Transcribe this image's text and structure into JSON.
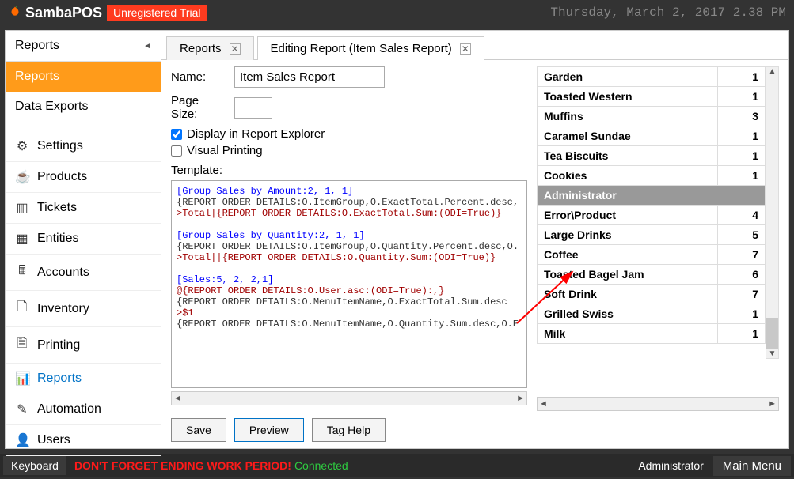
{
  "titlebar": {
    "app_name": "SambaPOS",
    "trial_badge": "Unregistered Trial",
    "datetime": "Thursday, March 2, 2017 2.38 PM"
  },
  "sidebar": {
    "header": "Reports",
    "top_items": [
      "Reports",
      "Data Exports"
    ],
    "top_active_index": 0,
    "bottom_items": [
      {
        "icon": "⚙",
        "label": "Settings"
      },
      {
        "icon": "☕",
        "label": "Products"
      },
      {
        "icon": "▥",
        "label": "Tickets"
      },
      {
        "icon": "▦",
        "label": "Entities"
      },
      {
        "icon": "🖩",
        "label": "Accounts"
      },
      {
        "icon": "🗋",
        "label": "Inventory"
      },
      {
        "icon": "🗎",
        "label": "Printing"
      },
      {
        "icon": "📊",
        "label": "Reports"
      },
      {
        "icon": "✎",
        "label": "Automation"
      },
      {
        "icon": "👤",
        "label": "Users"
      }
    ],
    "bottom_selected_index": 7
  },
  "tabs": {
    "items": [
      "Reports",
      "Editing Report (Item Sales Report)"
    ],
    "active_index": 1
  },
  "form": {
    "name_label": "Name:",
    "name_value": "Item Sales Report",
    "pagesize_label": "Page Size:",
    "pagesize_value": "",
    "display_explorer_label": "Display in Report Explorer",
    "display_explorer_checked": true,
    "visual_printing_label": "Visual Printing",
    "visual_printing_checked": false,
    "template_label": "Template:",
    "template_lines": [
      {
        "cls": "blue",
        "text": "[Group Sales by Amount:2, 1, 1]"
      },
      {
        "cls": "dark",
        "text": "{REPORT ORDER DETAILS:O.ItemGroup,O.ExactTotal.Percent.desc,"
      },
      {
        "cls": "red",
        "text": ">Total|{REPORT ORDER DETAILS:O.ExactTotal.Sum:(ODI=True)}"
      },
      {
        "cls": "dark",
        "text": ""
      },
      {
        "cls": "blue",
        "text": "[Group Sales by Quantity:2, 1, 1]"
      },
      {
        "cls": "dark",
        "text": "{REPORT ORDER DETAILS:O.ItemGroup,O.Quantity.Percent.desc,O."
      },
      {
        "cls": "red",
        "text": ">Total||{REPORT ORDER DETAILS:O.Quantity.Sum:(ODI=True)}"
      },
      {
        "cls": "dark",
        "text": ""
      },
      {
        "cls": "blue",
        "text": "[Sales:5, 2, 2,1]"
      },
      {
        "cls": "red",
        "text": "@{REPORT ORDER DETAILS:O.User.asc:(ODI=True):,}"
      },
      {
        "cls": "dark",
        "text": "{REPORT ORDER DETAILS:O.MenuItemName,O.ExactTotal.Sum.desc"
      },
      {
        "cls": "red",
        "text": ">$1"
      },
      {
        "cls": "dark",
        "text": "{REPORT ORDER DETAILS:O.MenuItemName,O.Quantity.Sum.desc,O.E"
      }
    ]
  },
  "buttons": {
    "save": "Save",
    "preview": "Preview",
    "taghelp": "Tag Help"
  },
  "results": {
    "rows": [
      {
        "type": "data",
        "label": "Garden",
        "value": "1"
      },
      {
        "type": "data",
        "label": "Toasted Western",
        "value": "1"
      },
      {
        "type": "data",
        "label": "Muffins",
        "value": "3"
      },
      {
        "type": "data",
        "label": "Caramel Sundae",
        "value": "1"
      },
      {
        "type": "data",
        "label": "Tea Biscuits",
        "value": "1"
      },
      {
        "type": "data",
        "label": "Cookies",
        "value": "1"
      },
      {
        "type": "header",
        "label": "Administrator",
        "value": ""
      },
      {
        "type": "data",
        "label": "Error\\Product",
        "value": "4"
      },
      {
        "type": "data",
        "label": "Large Drinks",
        "value": "5"
      },
      {
        "type": "data",
        "label": "Coffee",
        "value": "7"
      },
      {
        "type": "data",
        "label": "Toasted Bagel Jam",
        "value": "6"
      },
      {
        "type": "data",
        "label": "Soft Drink",
        "value": "7"
      },
      {
        "type": "data",
        "label": "Grilled Swiss",
        "value": "1"
      },
      {
        "type": "data",
        "label": "Milk",
        "value": "1"
      }
    ]
  },
  "statusbar": {
    "keyboard": "Keyboard",
    "warning": "DON'T FORGET ENDING WORK PERIOD!",
    "connected": "Connected",
    "admin": "Administrator",
    "main_menu": "Main Menu"
  }
}
